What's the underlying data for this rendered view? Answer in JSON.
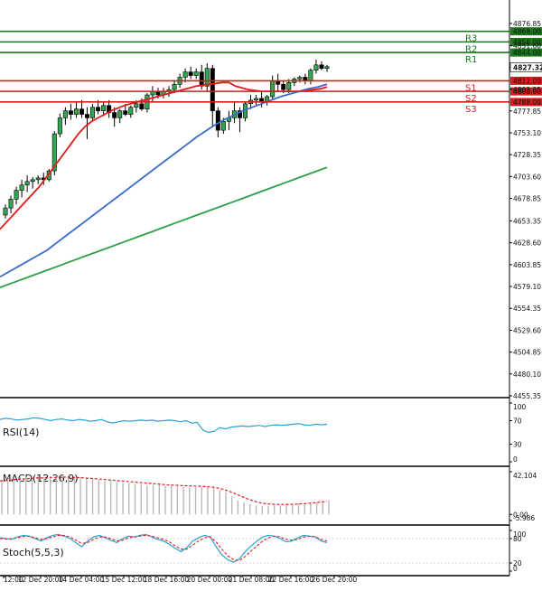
{
  "chart_data": {
    "type": "candlestick",
    "price_axis": {
      "ylim": [
        4455.35,
        4876.85
      ],
      "ticks": [
        "4876.85",
        "4851.60",
        "4827.32",
        "4802.35",
        "4777.85",
        "4753.10",
        "4728.35",
        "4703.60",
        "4678.85",
        "4653.35",
        "4628.60",
        "4603.85",
        "4579.10",
        "4554.35",
        "4529.60",
        "4504.85",
        "4480.10",
        "4455.35"
      ],
      "current_price": "4827.32"
    },
    "levels": [
      {
        "name": "R3",
        "value": 4868.0,
        "label": "4868.00",
        "color": "#1a7a1a"
      },
      {
        "name": "R2",
        "value": 4856.0,
        "label": "4856.00",
        "color": "#1a7a1a"
      },
      {
        "name": "R1",
        "value": 4844.0,
        "label": "4844.00",
        "color": "#1a7a1a"
      },
      {
        "name": "S1",
        "value": 4812.0,
        "label": "4812.00",
        "color": "#d11f1f"
      },
      {
        "name": "S2",
        "value": 4800.0,
        "label": "4800.00",
        "color": "#d11f1f"
      },
      {
        "name": "S3",
        "value": 4788.0,
        "label": "4788.00",
        "color": "#d11f1f"
      }
    ],
    "candles": [
      {
        "o": 4660,
        "h": 4672,
        "l": 4656,
        "c": 4668
      },
      {
        "o": 4668,
        "h": 4682,
        "l": 4662,
        "c": 4678
      },
      {
        "o": 4678,
        "h": 4692,
        "l": 4672,
        "c": 4688
      },
      {
        "o": 4688,
        "h": 4700,
        "l": 4680,
        "c": 4694
      },
      {
        "o": 4694,
        "h": 4705,
        "l": 4686,
        "c": 4698
      },
      {
        "o": 4698,
        "h": 4703,
        "l": 4690,
        "c": 4700
      },
      {
        "o": 4700,
        "h": 4705,
        "l": 4695,
        "c": 4702
      },
      {
        "o": 4702,
        "h": 4708,
        "l": 4694,
        "c": 4700
      },
      {
        "o": 4700,
        "h": 4712,
        "l": 4698,
        "c": 4710
      },
      {
        "o": 4710,
        "h": 4755,
        "l": 4705,
        "c": 4752
      },
      {
        "o": 4752,
        "h": 4775,
        "l": 4748,
        "c": 4770
      },
      {
        "o": 4770,
        "h": 4782,
        "l": 4762,
        "c": 4778
      },
      {
        "o": 4778,
        "h": 4786,
        "l": 4768,
        "c": 4774
      },
      {
        "o": 4774,
        "h": 4788,
        "l": 4770,
        "c": 4780
      },
      {
        "o": 4780,
        "h": 4790,
        "l": 4770,
        "c": 4774
      },
      {
        "o": 4774,
        "h": 4782,
        "l": 4746,
        "c": 4770
      },
      {
        "o": 4770,
        "h": 4786,
        "l": 4766,
        "c": 4782
      },
      {
        "o": 4782,
        "h": 4790,
        "l": 4774,
        "c": 4778
      },
      {
        "o": 4778,
        "h": 4788,
        "l": 4772,
        "c": 4784
      },
      {
        "o": 4784,
        "h": 4790,
        "l": 4770,
        "c": 4776
      },
      {
        "o": 4776,
        "h": 4782,
        "l": 4760,
        "c": 4770
      },
      {
        "o": 4770,
        "h": 4780,
        "l": 4764,
        "c": 4778
      },
      {
        "o": 4778,
        "h": 4786,
        "l": 4772,
        "c": 4774
      },
      {
        "o": 4774,
        "h": 4784,
        "l": 4770,
        "c": 4782
      },
      {
        "o": 4782,
        "h": 4790,
        "l": 4776,
        "c": 4786
      },
      {
        "o": 4786,
        "h": 4792,
        "l": 4778,
        "c": 4780
      },
      {
        "o": 4780,
        "h": 4798,
        "l": 4776,
        "c": 4796
      },
      {
        "o": 4796,
        "h": 4806,
        "l": 4788,
        "c": 4800
      },
      {
        "o": 4800,
        "h": 4804,
        "l": 4792,
        "c": 4796
      },
      {
        "o": 4796,
        "h": 4804,
        "l": 4792,
        "c": 4800
      },
      {
        "o": 4800,
        "h": 4806,
        "l": 4794,
        "c": 4802
      },
      {
        "o": 4802,
        "h": 4812,
        "l": 4798,
        "c": 4808
      },
      {
        "o": 4808,
        "h": 4820,
        "l": 4804,
        "c": 4816
      },
      {
        "o": 4816,
        "h": 4826,
        "l": 4810,
        "c": 4822
      },
      {
        "o": 4822,
        "h": 4828,
        "l": 4814,
        "c": 4818
      },
      {
        "o": 4818,
        "h": 4826,
        "l": 4814,
        "c": 4822
      },
      {
        "o": 4822,
        "h": 4830,
        "l": 4802,
        "c": 4806
      },
      {
        "o": 4806,
        "h": 4832,
        "l": 4800,
        "c": 4826
      },
      {
        "o": 4826,
        "h": 4830,
        "l": 4760,
        "c": 4778
      },
      {
        "o": 4778,
        "h": 4782,
        "l": 4748,
        "c": 4756
      },
      {
        "o": 4756,
        "h": 4770,
        "l": 4752,
        "c": 4766
      },
      {
        "o": 4766,
        "h": 4778,
        "l": 4756,
        "c": 4770
      },
      {
        "o": 4770,
        "h": 4788,
        "l": 4764,
        "c": 4778
      },
      {
        "o": 4778,
        "h": 4782,
        "l": 4754,
        "c": 4770
      },
      {
        "o": 4770,
        "h": 4788,
        "l": 4766,
        "c": 4786
      },
      {
        "o": 4786,
        "h": 4796,
        "l": 4780,
        "c": 4790
      },
      {
        "o": 4790,
        "h": 4796,
        "l": 4784,
        "c": 4792
      },
      {
        "o": 4792,
        "h": 4800,
        "l": 4782,
        "c": 4788
      },
      {
        "o": 4788,
        "h": 4796,
        "l": 4784,
        "c": 4794
      },
      {
        "o": 4794,
        "h": 4818,
        "l": 4790,
        "c": 4812
      },
      {
        "o": 4812,
        "h": 4820,
        "l": 4800,
        "c": 4808
      },
      {
        "o": 4808,
        "h": 4812,
        "l": 4798,
        "c": 4802
      },
      {
        "o": 4802,
        "h": 4814,
        "l": 4798,
        "c": 4810
      },
      {
        "o": 4810,
        "h": 4816,
        "l": 4806,
        "c": 4814
      },
      {
        "o": 4814,
        "h": 4818,
        "l": 4810,
        "c": 4816
      },
      {
        "o": 4816,
        "h": 4820,
        "l": 4808,
        "c": 4812
      },
      {
        "o": 4812,
        "h": 4826,
        "l": 4808,
        "c": 4824
      },
      {
        "o": 4824,
        "h": 4836,
        "l": 4820,
        "c": 4830
      },
      {
        "o": 4830,
        "h": 4834,
        "l": 4824,
        "c": 4826
      },
      {
        "o": 4826,
        "h": 4830,
        "l": 4822,
        "c": 4828
      }
    ],
    "moving_averages": [
      {
        "color": "#e31b1b",
        "values": [
          4644,
          4652,
          4660,
          4668,
          4676,
          4684,
          4692,
          4702,
          4712,
          4722,
          4732,
          4742,
          4752,
          4760,
          4766,
          4770,
          4774,
          4778,
          4781,
          4784,
          4786,
          4788,
          4790,
          4792,
          4794,
          4796,
          4798,
          4800,
          4802,
          4804,
          4806,
          4807,
          4808,
          4809,
          4810,
          4810,
          4806,
          4804,
          4802,
          4801,
          4800,
          4800,
          4800,
          4800,
          4800,
          4800,
          4800,
          4801,
          4802,
          4803,
          4805
        ]
      },
      {
        "color": "#3a6bc8",
        "values": [
          4590,
          4596,
          4602,
          4608,
          4614,
          4620,
          4628,
          4636,
          4644,
          4652,
          4660,
          4668,
          4676,
          4684,
          4692,
          4700,
          4708,
          4716,
          4724,
          4732,
          4740,
          4748,
          4755,
          4762,
          4768,
          4773,
          4778,
          4782,
          4786,
          4790,
          4794,
          4797,
          4800,
          4803,
          4805,
          4808
        ]
      },
      {
        "color": "#2ea04a",
        "values": [
          4578,
          4582,
          4586,
          4590,
          4594,
          4598,
          4602,
          4606,
          4610,
          4614,
          4618,
          4622,
          4626,
          4630,
          4634,
          4638,
          4642,
          4646,
          4650,
          4654,
          4658,
          4662,
          4666,
          4670,
          4674,
          4678,
          4682,
          4686,
          4690,
          4694,
          4698,
          4702,
          4706,
          4710,
          4714
        ]
      }
    ],
    "x_ticks": [
      "12:00",
      "12 Dec 20:00",
      "14 Dec 04:00",
      "15 Dec 12:00",
      "18 Dec 16:00",
      "20 Dec 00:00",
      "21 Dec 08:00",
      "22 Dec 16:00",
      "26 Dec 20:00"
    ],
    "indicators": {
      "rsi": {
        "title": "RSI(14)",
        "ticks": [
          "100",
          "70",
          "30",
          "0"
        ],
        "ylim": [
          0,
          100
        ],
        "values": [
          72,
          74,
          73,
          71,
          72,
          73,
          75,
          74,
          72,
          70,
          72,
          73,
          71,
          70,
          72,
          71,
          69,
          70,
          72,
          68,
          66,
          68,
          70,
          69,
          70,
          71,
          70,
          71,
          69,
          70,
          71,
          70,
          68,
          70,
          66,
          67,
          54,
          50,
          52,
          58,
          56,
          59,
          60,
          61,
          60,
          61,
          62,
          60,
          62,
          63,
          62,
          63,
          64,
          65,
          63,
          62,
          64,
          63,
          64
        ]
      },
      "macd": {
        "title": "MACD(12,26,9)",
        "ticks": [
          "42.104",
          "0.00",
          "-5.986"
        ],
        "ylim": [
          -5.986,
          42.104
        ],
        "histogram": [
          34,
          35,
          36,
          37,
          37,
          38,
          38,
          37,
          37,
          38,
          39,
          38,
          37,
          37,
          36,
          35,
          34,
          33,
          33,
          32,
          31,
          31,
          30,
          30,
          29,
          29,
          29,
          28,
          28,
          28,
          27,
          27,
          27,
          27,
          27,
          26,
          24,
          22,
          18,
          14,
          12,
          10,
          9,
          8,
          8,
          9,
          9,
          10,
          10,
          11,
          11,
          12,
          12,
          13,
          14
        ],
        "signal": [
          33,
          33.5,
          34,
          34.5,
          35,
          35.5,
          36,
          36,
          36.5,
          36.5,
          36.8,
          36.8,
          36.6,
          36.3,
          36,
          35.5,
          35,
          34.5,
          34,
          33.5,
          33,
          32.5,
          32,
          31.5,
          31,
          30.5,
          30,
          29.5,
          29,
          28.8,
          28.5,
          28.2,
          28,
          27.8,
          27.5,
          27,
          26,
          24.5,
          22.5,
          20,
          17.5,
          15,
          13,
          11.5,
          10.5,
          10,
          9.8,
          9.8,
          10,
          10.2,
          10.6,
          11,
          11.6,
          12.2,
          13
        ]
      },
      "stoch": {
        "title": "Stoch(5,5,3)",
        "ticks": [
          "100",
          "80",
          "20",
          "0"
        ],
        "ylim": [
          0,
          100
        ],
        "main": [
          82,
          80,
          78,
          84,
          88,
          86,
          80,
          74,
          82,
          88,
          90,
          86,
          80,
          70,
          60,
          74,
          84,
          88,
          82,
          76,
          70,
          80,
          86,
          84,
          88,
          90,
          84,
          78,
          74,
          66,
          56,
          48,
          58,
          74,
          82,
          88,
          84,
          60,
          40,
          28,
          22,
          30,
          48,
          62,
          74,
          84,
          88,
          86,
          80,
          72,
          74,
          82,
          88,
          86,
          84,
          74,
          70
        ],
        "signal": [
          80,
          79,
          80,
          82,
          85,
          86,
          82,
          78,
          80,
          84,
          88,
          88,
          84,
          76,
          68,
          70,
          78,
          84,
          84,
          80,
          74,
          76,
          82,
          84,
          86,
          88,
          86,
          82,
          78,
          72,
          62,
          54,
          54,
          64,
          74,
          82,
          84,
          72,
          54,
          38,
          28,
          26,
          36,
          50,
          62,
          74,
          82,
          86,
          84,
          78,
          76,
          78,
          84,
          86,
          84,
          78,
          74
        ]
      }
    }
  }
}
